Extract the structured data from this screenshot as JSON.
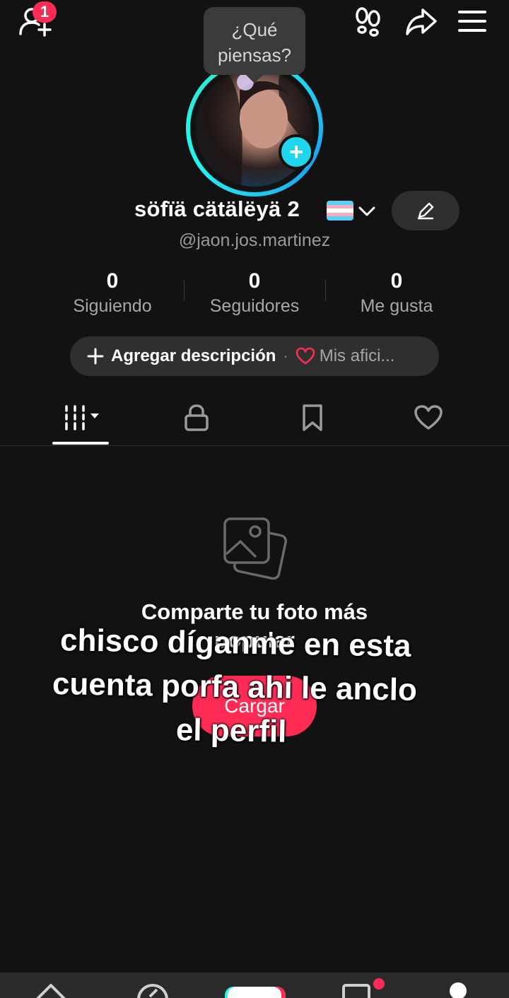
{
  "topbar": {
    "friends_badge": "1"
  },
  "avatar": {
    "thought_bubble": "¿Qué piensas?"
  },
  "profile": {
    "display_name": "söfïä cätälëyä  2",
    "username": "@jaon.jos.martinez"
  },
  "stats": [
    {
      "value": "0",
      "label": "Siguiendo"
    },
    {
      "value": "0",
      "label": "Seguidores"
    },
    {
      "value": "0",
      "label": "Me gusta"
    }
  ],
  "bio": {
    "add_description": "Agregar descripción",
    "separator": "·",
    "hobbies": "Mis afici..."
  },
  "empty_state": {
    "title": "Comparte tu foto más popular",
    "upload_button": "Cargar"
  },
  "overlay_text": {
    "line1": "chisco díganme en esta",
    "line2": "cuenta porfa ahi le anclo",
    "line3": "el perfil"
  },
  "colors": {
    "accent": "#fe2c55",
    "ring": "#25f4ee",
    "background": "#121212"
  }
}
